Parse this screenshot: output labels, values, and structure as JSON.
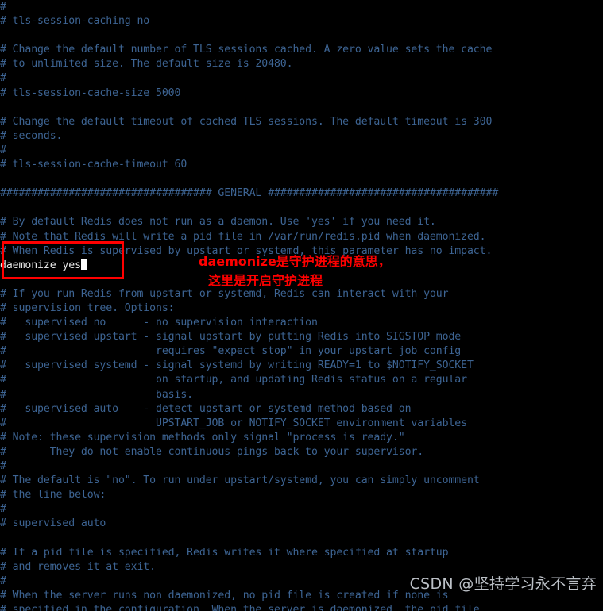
{
  "terminal": {
    "background_color": "#000000",
    "comment_color": "#3d6493",
    "active_line_color": "#e8e8e8",
    "annotation_color": "#ff0000",
    "cursor": "block-cursor"
  },
  "lines": [
    {
      "text": "#",
      "active": false
    },
    {
      "text": "# tls-session-caching no",
      "active": false
    },
    {
      "text": "",
      "active": false
    },
    {
      "text": "# Change the default number of TLS sessions cached. A zero value sets the cache",
      "active": false
    },
    {
      "text": "# to unlimited size. The default size is 20480.",
      "active": false
    },
    {
      "text": "#",
      "active": false
    },
    {
      "text": "# tls-session-cache-size 5000",
      "active": false
    },
    {
      "text": "",
      "active": false
    },
    {
      "text": "# Change the default timeout of cached TLS sessions. The default timeout is 300",
      "active": false
    },
    {
      "text": "# seconds.",
      "active": false
    },
    {
      "text": "#",
      "active": false
    },
    {
      "text": "# tls-session-cache-timeout 60",
      "active": false
    },
    {
      "text": "",
      "active": false
    },
    {
      "text": "################################## GENERAL #####################################",
      "active": false
    },
    {
      "text": "",
      "active": false
    },
    {
      "text": "# By default Redis does not run as a daemon. Use 'yes' if you need it.",
      "active": false
    },
    {
      "text": "# Note that Redis will write a pid file in /var/run/redis.pid when daemonized.",
      "active": false
    },
    {
      "text": "# When Redis is supervised by upstart or systemd, this parameter has no impact.",
      "active": false
    },
    {
      "text": "daemonize yes",
      "active": true,
      "cursor": true
    },
    {
      "text": "",
      "active": false
    },
    {
      "text": "# If you run Redis from upstart or systemd, Redis can interact with your",
      "active": false
    },
    {
      "text": "# supervision tree. Options:",
      "active": false
    },
    {
      "text": "#   supervised no      - no supervision interaction",
      "active": false
    },
    {
      "text": "#   supervised upstart - signal upstart by putting Redis into SIGSTOP mode",
      "active": false
    },
    {
      "text": "#                        requires \"expect stop\" in your upstart job config",
      "active": false
    },
    {
      "text": "#   supervised systemd - signal systemd by writing READY=1 to $NOTIFY_SOCKET",
      "active": false
    },
    {
      "text": "#                        on startup, and updating Redis status on a regular",
      "active": false
    },
    {
      "text": "#                        basis.",
      "active": false
    },
    {
      "text": "#   supervised auto    - detect upstart or systemd method based on",
      "active": false
    },
    {
      "text": "#                        UPSTART_JOB or NOTIFY_SOCKET environment variables",
      "active": false
    },
    {
      "text": "# Note: these supervision methods only signal \"process is ready.\"",
      "active": false
    },
    {
      "text": "#       They do not enable continuous pings back to your supervisor.",
      "active": false
    },
    {
      "text": "#",
      "active": false
    },
    {
      "text": "# The default is \"no\". To run under upstart/systemd, you can simply uncomment",
      "active": false
    },
    {
      "text": "# the line below:",
      "active": false
    },
    {
      "text": "#",
      "active": false
    },
    {
      "text": "# supervised auto",
      "active": false
    },
    {
      "text": "",
      "active": false
    },
    {
      "text": "# If a pid file is specified, Redis writes it where specified at startup",
      "active": false
    },
    {
      "text": "# and removes it at exit.",
      "active": false
    },
    {
      "text": "#",
      "active": false
    },
    {
      "text": "# When the server runs non daemonized, no pid file is created if none is",
      "active": false
    },
    {
      "text": "# specified in the configuration. When the server is daemonized, the pid file",
      "active": false
    }
  ],
  "annotations": {
    "box_label": "daemonize-highlight-box",
    "line1": "daemonize是守护进程的意思，",
    "line2": "这里是开启守护进程"
  },
  "watermark": {
    "text": "CSDN @坚持学习永不言弃"
  }
}
